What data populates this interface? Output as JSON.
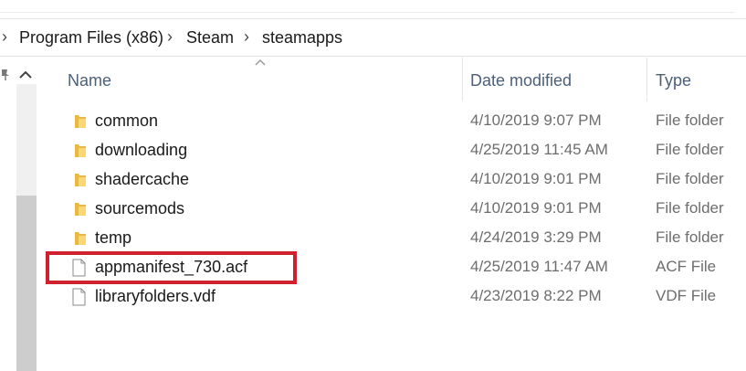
{
  "breadcrumb": {
    "items": [
      "Program Files (x86)",
      "Steam",
      "steamapps"
    ],
    "separator": "›"
  },
  "columns": {
    "name": "Name",
    "date_modified": "Date modified",
    "type": "Type"
  },
  "files": [
    {
      "name": "common",
      "date": "4/10/2019 9:07 PM",
      "type": "File folder",
      "icon": "folder-icon"
    },
    {
      "name": "downloading",
      "date": "4/25/2019 11:45 AM",
      "type": "File folder",
      "icon": "folder-icon"
    },
    {
      "name": "shadercache",
      "date": "4/10/2019 9:01 PM",
      "type": "File folder",
      "icon": "folder-icon"
    },
    {
      "name": "sourcemods",
      "date": "4/10/2019 9:01 PM",
      "type": "File folder",
      "icon": "folder-icon"
    },
    {
      "name": "temp",
      "date": "4/24/2019 3:29 PM",
      "type": "File folder",
      "icon": "folder-icon"
    },
    {
      "name": "appmanifest_730.acf",
      "date": "4/25/2019 11:47 AM",
      "type": "ACF File",
      "icon": "file-icon"
    },
    {
      "name": "libraryfolders.vdf",
      "date": "4/23/2019 8:22 PM",
      "type": "VDF File",
      "icon": "file-icon"
    }
  ],
  "highlighted_file": "appmanifest_730.acf",
  "colors": {
    "highlight": "#d0212e",
    "folder": "#f8d775",
    "header_text": "#4c607a"
  }
}
